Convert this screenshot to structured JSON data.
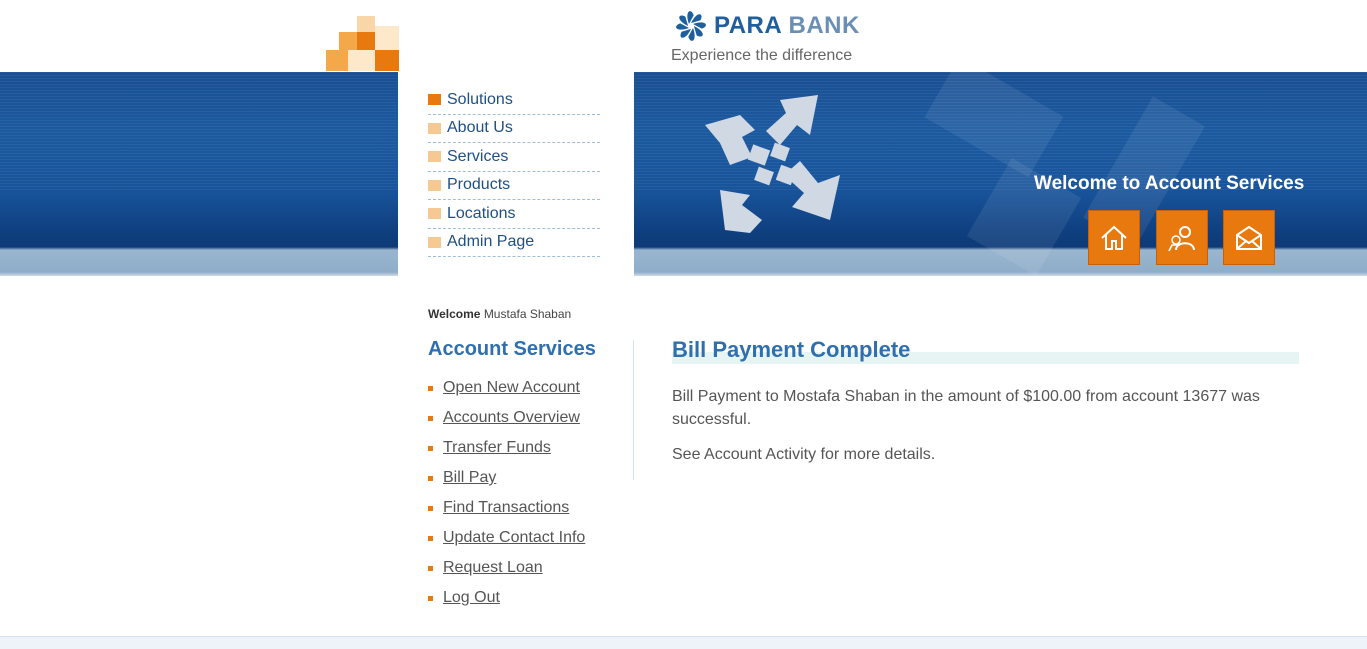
{
  "brand": {
    "name_primary": "PARA",
    "name_secondary": "BANK",
    "caption": "Experience the difference"
  },
  "header": {
    "welcome": "Welcome to Account Services",
    "buttons": [
      {
        "icon": "home-icon"
      },
      {
        "icon": "about-icon"
      },
      {
        "icon": "contact-icon"
      }
    ]
  },
  "topnav": {
    "items": [
      {
        "label": "Solutions",
        "active": true
      },
      {
        "label": "About Us"
      },
      {
        "label": "Services"
      },
      {
        "label": "Products"
      },
      {
        "label": "Locations"
      },
      {
        "label": "Admin Page"
      }
    ]
  },
  "sidebar": {
    "welcome_word": "Welcome",
    "user_name": "Mustafa Shaban",
    "title": "Account Services",
    "links": [
      "Open New Account",
      "Accounts Overview",
      "Transfer Funds",
      "Bill Pay",
      "Find Transactions",
      "Update Contact Info",
      "Request Loan",
      "Log Out"
    ]
  },
  "main": {
    "title": "Bill Payment Complete",
    "message": "Bill Payment to Mostafa Shaban in the amount of $100.00 from account 13677 was successful.",
    "note": "See Account Activity for more details."
  },
  "colors": {
    "accent": "#e8790e",
    "brand_blue": "#1f5f9e",
    "title_blue": "#2f6fae"
  }
}
